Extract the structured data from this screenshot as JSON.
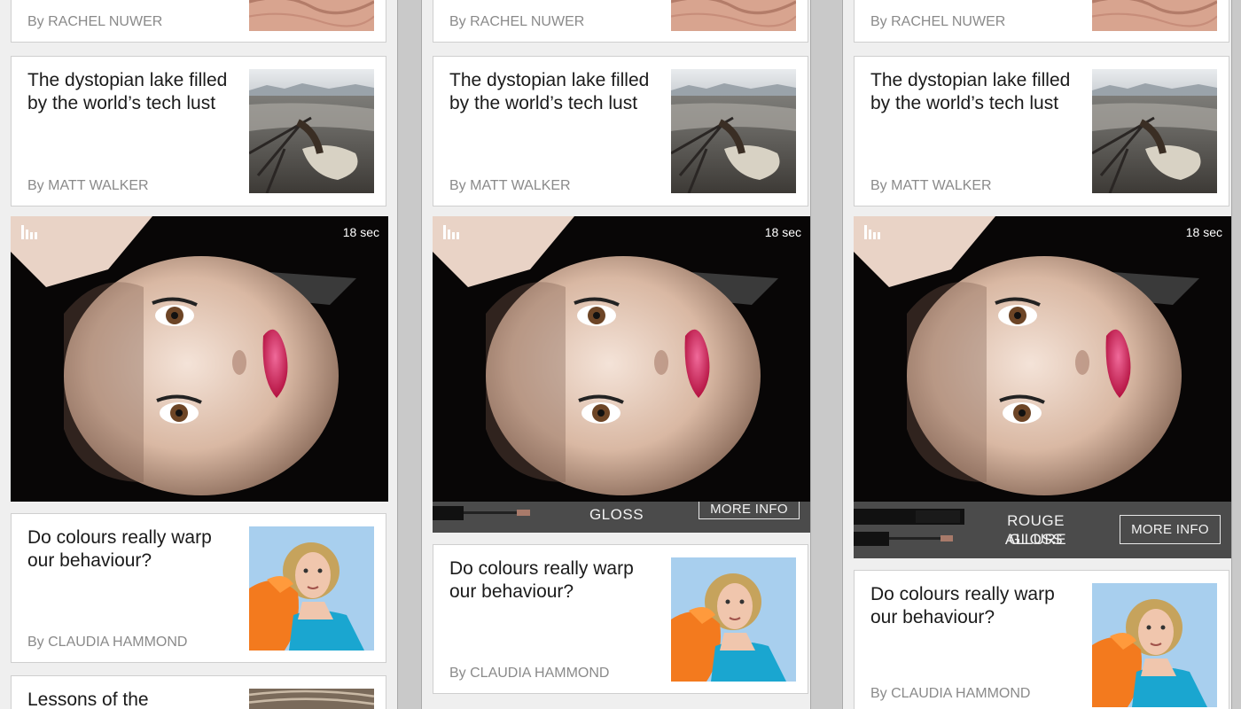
{
  "feed": {
    "card_top": {
      "byline": "By RACHEL NUWER"
    },
    "card_lake": {
      "title": "The dystopian lake filled by the world’s tech lust",
      "byline": "By MATT WALKER"
    },
    "ad": {
      "timer": "18 sec",
      "banner_line1": "ROUGE ALLURE",
      "banner_line2": "GLOSS",
      "more_info": "MORE INFO"
    },
    "card_colours": {
      "title": "Do colours really warp our behaviour?",
      "byline": "By CLAUDIA HAMMOND"
    },
    "card_next": {
      "title": "Lessons of the"
    }
  }
}
